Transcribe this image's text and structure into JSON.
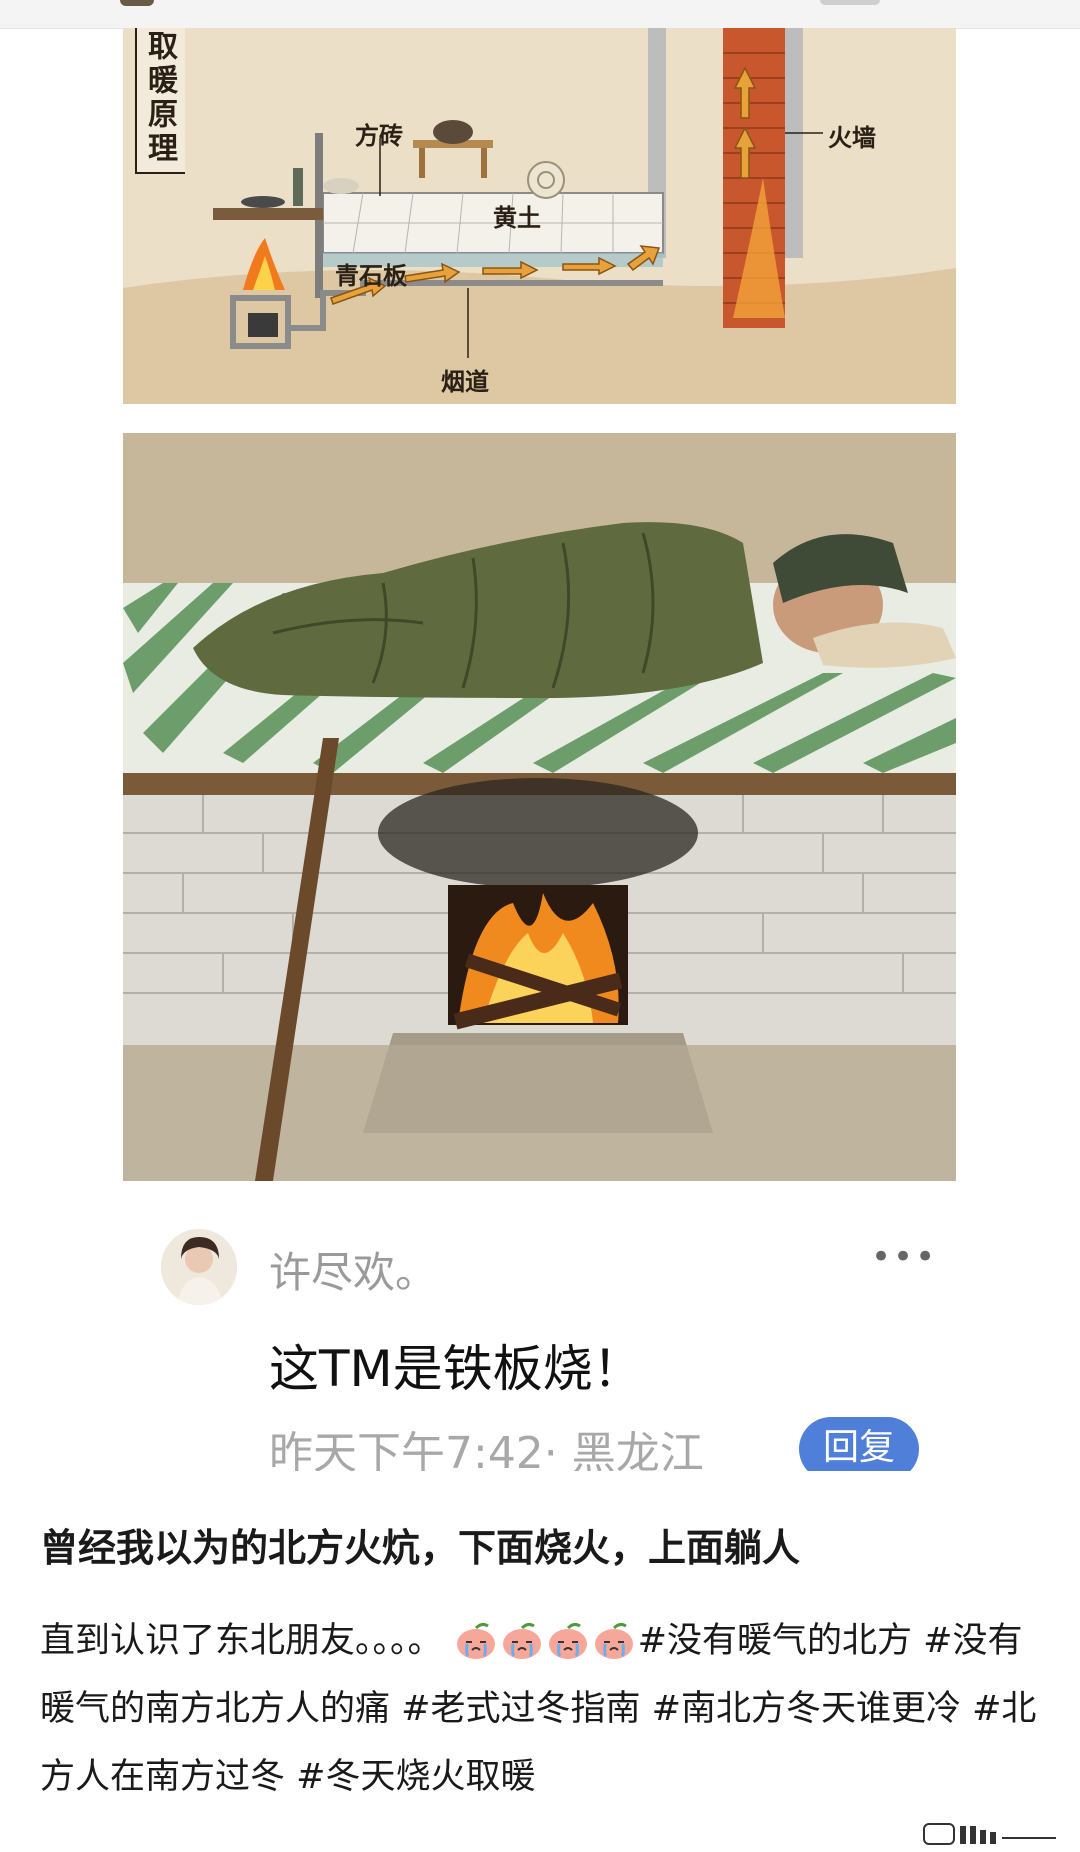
{
  "diagram": {
    "title": "取暖原理",
    "labels": {
      "square_brick": "方砖",
      "fire_wall": "火墙",
      "yellow_earth": "黄土",
      "bluestone_slab": "青石板",
      "flue": "烟道"
    }
  },
  "comment": {
    "username": "许尽欢。",
    "text": "这TM是铁板烧！",
    "meta": "昨天下午7:42· 黑龙江",
    "reply_label": "回复",
    "more_icon": "more-dots-icon"
  },
  "post": {
    "title": "曾经我以为的北方火炕，下面烧火，上面躺人",
    "intro": "直到认识了东北朋友。。。。",
    "emoji_icon": "crying-peach-emoji",
    "emoji_count": 4,
    "hashtags": [
      "#没有暖气的北方",
      "#没有暖气的南方北方人的痛",
      "#老式过冬指南",
      "#南北方冬天谁更冷",
      "#北方人在南方过冬",
      "#冬天烧火取暖"
    ]
  }
}
